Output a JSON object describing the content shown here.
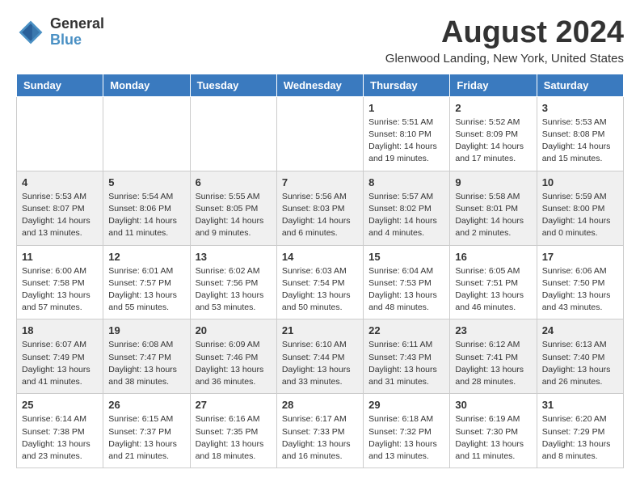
{
  "header": {
    "logo_line1": "General",
    "logo_line2": "Blue",
    "month": "August 2024",
    "location": "Glenwood Landing, New York, United States"
  },
  "weekdays": [
    "Sunday",
    "Monday",
    "Tuesday",
    "Wednesday",
    "Thursday",
    "Friday",
    "Saturday"
  ],
  "weeks": [
    [
      {
        "day": "",
        "content": ""
      },
      {
        "day": "",
        "content": ""
      },
      {
        "day": "",
        "content": ""
      },
      {
        "day": "",
        "content": ""
      },
      {
        "day": "1",
        "content": "Sunrise: 5:51 AM\nSunset: 8:10 PM\nDaylight: 14 hours\nand 19 minutes."
      },
      {
        "day": "2",
        "content": "Sunrise: 5:52 AM\nSunset: 8:09 PM\nDaylight: 14 hours\nand 17 minutes."
      },
      {
        "day": "3",
        "content": "Sunrise: 5:53 AM\nSunset: 8:08 PM\nDaylight: 14 hours\nand 15 minutes."
      }
    ],
    [
      {
        "day": "4",
        "content": "Sunrise: 5:53 AM\nSunset: 8:07 PM\nDaylight: 14 hours\nand 13 minutes."
      },
      {
        "day": "5",
        "content": "Sunrise: 5:54 AM\nSunset: 8:06 PM\nDaylight: 14 hours\nand 11 minutes."
      },
      {
        "day": "6",
        "content": "Sunrise: 5:55 AM\nSunset: 8:05 PM\nDaylight: 14 hours\nand 9 minutes."
      },
      {
        "day": "7",
        "content": "Sunrise: 5:56 AM\nSunset: 8:03 PM\nDaylight: 14 hours\nand 6 minutes."
      },
      {
        "day": "8",
        "content": "Sunrise: 5:57 AM\nSunset: 8:02 PM\nDaylight: 14 hours\nand 4 minutes."
      },
      {
        "day": "9",
        "content": "Sunrise: 5:58 AM\nSunset: 8:01 PM\nDaylight: 14 hours\nand 2 minutes."
      },
      {
        "day": "10",
        "content": "Sunrise: 5:59 AM\nSunset: 8:00 PM\nDaylight: 14 hours\nand 0 minutes."
      }
    ],
    [
      {
        "day": "11",
        "content": "Sunrise: 6:00 AM\nSunset: 7:58 PM\nDaylight: 13 hours\nand 57 minutes."
      },
      {
        "day": "12",
        "content": "Sunrise: 6:01 AM\nSunset: 7:57 PM\nDaylight: 13 hours\nand 55 minutes."
      },
      {
        "day": "13",
        "content": "Sunrise: 6:02 AM\nSunset: 7:56 PM\nDaylight: 13 hours\nand 53 minutes."
      },
      {
        "day": "14",
        "content": "Sunrise: 6:03 AM\nSunset: 7:54 PM\nDaylight: 13 hours\nand 50 minutes."
      },
      {
        "day": "15",
        "content": "Sunrise: 6:04 AM\nSunset: 7:53 PM\nDaylight: 13 hours\nand 48 minutes."
      },
      {
        "day": "16",
        "content": "Sunrise: 6:05 AM\nSunset: 7:51 PM\nDaylight: 13 hours\nand 46 minutes."
      },
      {
        "day": "17",
        "content": "Sunrise: 6:06 AM\nSunset: 7:50 PM\nDaylight: 13 hours\nand 43 minutes."
      }
    ],
    [
      {
        "day": "18",
        "content": "Sunrise: 6:07 AM\nSunset: 7:49 PM\nDaylight: 13 hours\nand 41 minutes."
      },
      {
        "day": "19",
        "content": "Sunrise: 6:08 AM\nSunset: 7:47 PM\nDaylight: 13 hours\nand 38 minutes."
      },
      {
        "day": "20",
        "content": "Sunrise: 6:09 AM\nSunset: 7:46 PM\nDaylight: 13 hours\nand 36 minutes."
      },
      {
        "day": "21",
        "content": "Sunrise: 6:10 AM\nSunset: 7:44 PM\nDaylight: 13 hours\nand 33 minutes."
      },
      {
        "day": "22",
        "content": "Sunrise: 6:11 AM\nSunset: 7:43 PM\nDaylight: 13 hours\nand 31 minutes."
      },
      {
        "day": "23",
        "content": "Sunrise: 6:12 AM\nSunset: 7:41 PM\nDaylight: 13 hours\nand 28 minutes."
      },
      {
        "day": "24",
        "content": "Sunrise: 6:13 AM\nSunset: 7:40 PM\nDaylight: 13 hours\nand 26 minutes."
      }
    ],
    [
      {
        "day": "25",
        "content": "Sunrise: 6:14 AM\nSunset: 7:38 PM\nDaylight: 13 hours\nand 23 minutes."
      },
      {
        "day": "26",
        "content": "Sunrise: 6:15 AM\nSunset: 7:37 PM\nDaylight: 13 hours\nand 21 minutes."
      },
      {
        "day": "27",
        "content": "Sunrise: 6:16 AM\nSunset: 7:35 PM\nDaylight: 13 hours\nand 18 minutes."
      },
      {
        "day": "28",
        "content": "Sunrise: 6:17 AM\nSunset: 7:33 PM\nDaylight: 13 hours\nand 16 minutes."
      },
      {
        "day": "29",
        "content": "Sunrise: 6:18 AM\nSunset: 7:32 PM\nDaylight: 13 hours\nand 13 minutes."
      },
      {
        "day": "30",
        "content": "Sunrise: 6:19 AM\nSunset: 7:30 PM\nDaylight: 13 hours\nand 11 minutes."
      },
      {
        "day": "31",
        "content": "Sunrise: 6:20 AM\nSunset: 7:29 PM\nDaylight: 13 hours\nand 8 minutes."
      }
    ]
  ]
}
